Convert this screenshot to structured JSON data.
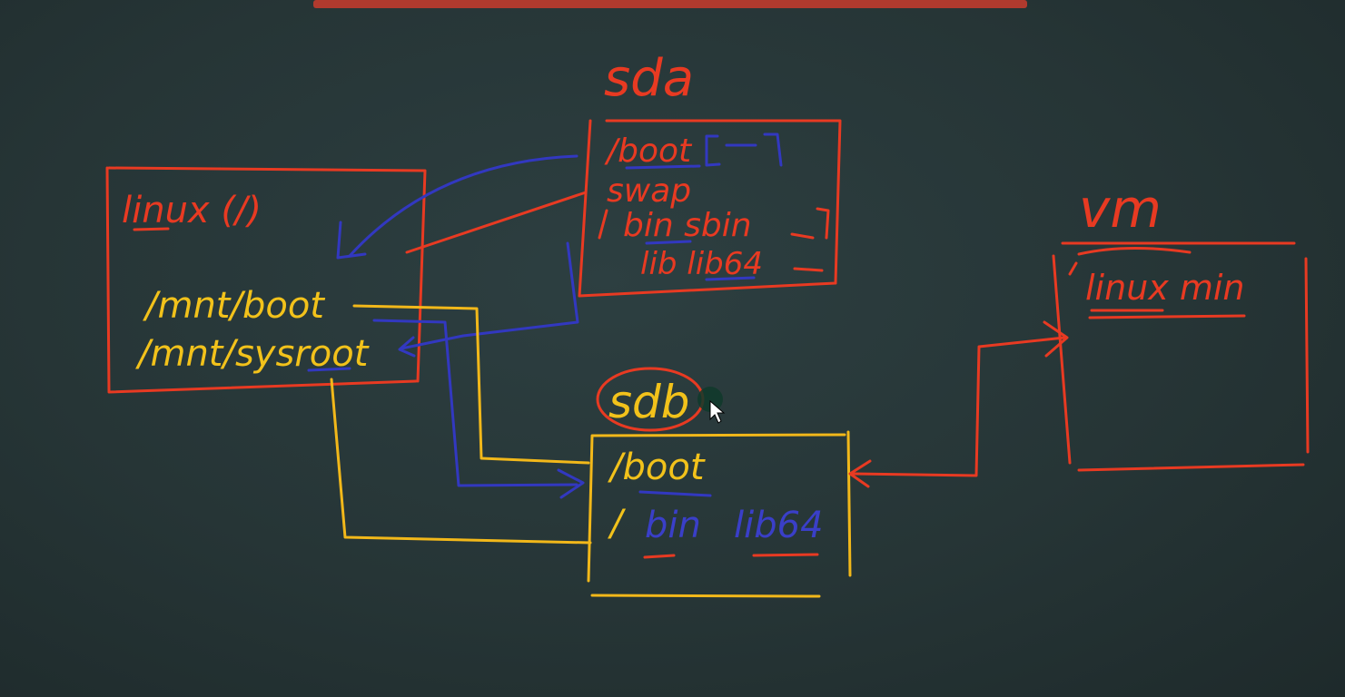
{
  "linux_box": {
    "title": "linux (/)",
    "mount_boot": "/mnt/boot",
    "mount_sysroot": "/mnt/sysroot"
  },
  "sda": {
    "label": "sda",
    "boot": "/boot",
    "swap": "swap",
    "bin_sbin": "bin sbin",
    "lib_lib64": "lib lib64"
  },
  "sdb": {
    "label": "sdb",
    "boot": "/boot",
    "slash": "/",
    "bin": "bin",
    "lib64": "lib64"
  },
  "vm": {
    "label": "vm",
    "content": "linux min"
  },
  "colors": {
    "red": "#e83a22",
    "yellow": "#f2c21b",
    "blue": "#3238c0",
    "board": "#263536"
  }
}
